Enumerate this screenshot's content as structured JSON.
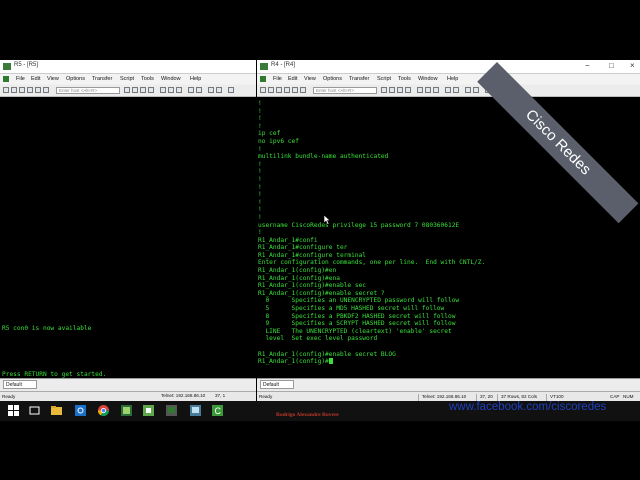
{
  "left_window": {
    "title": "R5 - [R5]",
    "menu": [
      "File",
      "Edit",
      "View",
      "Options",
      "Transfer",
      "Script",
      "Tools",
      "Window",
      "Help"
    ],
    "host_placeholder": "Enter host <Alt+R>",
    "terminal_lines": [
      "R5 con0 is now available",
      "",
      "",
      "",
      "",
      "Press RETURN to get started."
    ],
    "tab_label": "Default",
    "status": {
      "ready": "Ready"
    }
  },
  "right_window": {
    "title": "R4 - [R4]",
    "menu": [
      "File",
      "Edit",
      "View",
      "Options",
      "Transfer",
      "Script",
      "Tools",
      "Window",
      "Help"
    ],
    "host_placeholder": "Enter host <Alt+R>",
    "terminal_lines": [
      "!",
      "!",
      "!",
      "!",
      "ip cef",
      "no ipv6 cef",
      "!",
      "multilink bundle-name authenticated",
      "!",
      "!",
      "!",
      "!",
      "!",
      "!",
      "!",
      "!",
      "username CiscoRedes privilege 15 password 7 080360612E",
      "!",
      "R1_Andar_1#confi",
      "R1_Andar_1#configure ter",
      "R1_Andar_1#configure terminal",
      "Enter configuration commands, one per line.  End with CNTL/Z.",
      "R1_Andar_1(config)#en",
      "R1_Andar_1(config)#ena",
      "R1_Andar_1(config)#enable sec",
      "R1_Andar_1(config)#enable secret ?",
      "  0      Specifies an UNENCRYPTED password will follow",
      "  5      Specifies a MD5 HASHED secret will follow",
      "  8      Specifies a PBKDF2 HASHED secret will follow",
      "  9      Specifies a SCRYPT HASHED secret will follow",
      "  LINE   The UNENCRYPTED (cleartext) 'enable' secret",
      "  level  Set exec level password",
      "",
      "R1_Andar_1(config)#enable secret BLOG"
    ],
    "prompt_line": "R1_Andar_1(config)#",
    "tab_label": "Default",
    "status": {
      "ready": "Ready",
      "connection": "Telnet: 192.168.86.10",
      "cursor": "37, 20",
      "size": "37 Rows, 82 Cols",
      "term": "VT100",
      "cap": "CAP",
      "num": "NUM"
    }
  },
  "left_status": {
    "connection": "Telnet: 192.168.86.10",
    "cursor": "37, 1",
    "size": "37 Rows, 82 Cols",
    "term": "VT100"
  },
  "ribbon_text": "Cisco Redes",
  "watermark_url": "www.facebook.com/ciscoredes",
  "author": "Rodrigo Alexandre Rovere",
  "colors": {
    "terminal_text": "#39e039",
    "ribbon": "#5a5f6b",
    "watermark": "#1f3fbf",
    "author": "#c0392b"
  }
}
